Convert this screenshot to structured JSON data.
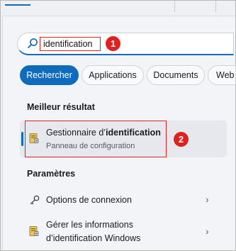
{
  "search": {
    "value": "identification",
    "step_badge": "1"
  },
  "tabs": [
    {
      "label": "Rechercher",
      "active": true
    },
    {
      "label": "Applications",
      "active": false
    },
    {
      "label": "Documents",
      "active": false
    },
    {
      "label": "Web",
      "active": false
    }
  ],
  "best_match": {
    "heading": "Meilleur résultat",
    "title_prefix": "Gestionnaire d’",
    "title_bold": "identification",
    "subtitle": "Panneau de configuration",
    "step_badge": "2"
  },
  "settings": {
    "heading": "Paramètres",
    "items": [
      {
        "label": "Options de connexion",
        "icon": "key-icon"
      },
      {
        "label_line1": "Gérer les informations",
        "label_line2": "d’identification Windows",
        "icon": "credential-manager-icon"
      }
    ]
  },
  "colors": {
    "accent": "#0f6cbd",
    "annotation": "#e0211d"
  }
}
